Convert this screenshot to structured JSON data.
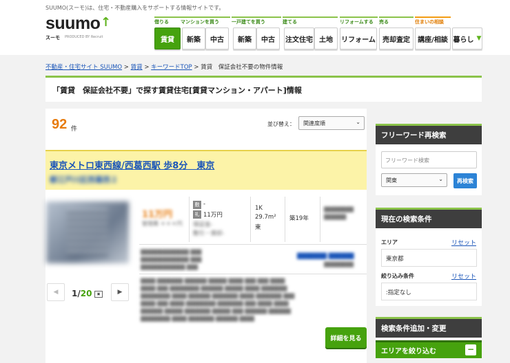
{
  "header": {
    "tagline": "SUUMO(スーモ)は、住宅・不動産購入をサポートする情報サイトです。",
    "logo_text": "suumo",
    "logo_sub": "スーモ",
    "logo_produced": "PRODUCED BY Recruit",
    "nav_groups": [
      {
        "label": "借りる",
        "color": "green",
        "buttons": [
          {
            "label": "賃貸",
            "active": true
          }
        ]
      },
      {
        "label": "マンションを買う",
        "color": "green",
        "buttons": [
          {
            "label": "新築"
          },
          {
            "label": "中古"
          }
        ]
      },
      {
        "label": "一戸建てを買う",
        "color": "green",
        "buttons": [
          {
            "label": "新築"
          },
          {
            "label": "中古"
          }
        ]
      },
      {
        "label": "建てる",
        "color": "green",
        "buttons": [
          {
            "label": "注文住宅"
          },
          {
            "label": "土地"
          }
        ]
      },
      {
        "label": "リフォームする",
        "color": "green",
        "buttons": [
          {
            "label": "リフォーム"
          }
        ]
      },
      {
        "label": "売る",
        "color": "green",
        "buttons": [
          {
            "label": "売却査定"
          }
        ]
      },
      {
        "label": "住まいの相談",
        "color": "orange",
        "buttons": [
          {
            "label": "講座/相談"
          }
        ]
      },
      {
        "label": "",
        "color": "none",
        "buttons": [
          {
            "label": "暮らし"
          }
        ]
      }
    ]
  },
  "breadcrumb": {
    "items": [
      "不動産・住宅サイト SUUMO",
      "賃貸",
      "キーワードTOP"
    ],
    "current": "賃貸　保証会社不要の物件情報"
  },
  "page_title": "「賃貸　保証会社不要」で探す賃貸住宅[賃貸マンション・アパート]情報",
  "results": {
    "count": "92",
    "count_unit": "件",
    "sort_label": "並び替え：",
    "sort_value": "関連度順",
    "card": {
      "title": "東京メトロ東西線/西葛西駅 歩8分　東京",
      "subtitle": "都江戸川区西葛西２",
      "price": "11万円",
      "mgmt": "管理費 ＊＊＊円",
      "deposit_tag": "敷",
      "deposit_value": "-",
      "key_tag": "礼",
      "key_value": "11万円",
      "guarantee": "保証金-",
      "shikibiki": "敷引・償却-",
      "layout": "1K",
      "area": "29.7m²",
      "direction": "東",
      "age": "築19年",
      "pager_current": "1",
      "pager_total": "20",
      "detail_button": "詳細を見る"
    }
  },
  "sidebar": {
    "freeword_head": "フリーワード再検索",
    "freeword_placeholder": "フリーワード検索",
    "freeword_area": "関東",
    "freeword_button": "再検索",
    "current_head": "現在の検索条件",
    "area_label": "エリア",
    "area_reset": "リセット",
    "area_value": "東京都",
    "narrow_label": "絞り込み条件",
    "narrow_reset": "リセット",
    "narrow_value": ":指定なし",
    "add_head": "検索条件追加・変更",
    "area_narrow": "エリアを絞り込む",
    "area_narrow_toggle": "−"
  }
}
